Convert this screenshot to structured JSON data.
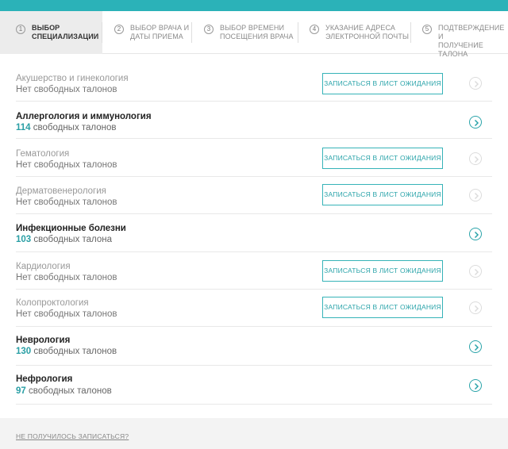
{
  "steps": [
    {
      "number": "1",
      "label_line1": "ВЫБОР",
      "label_line2": "СПЕЦИАЛИЗАЦИИ"
    },
    {
      "number": "2",
      "label_line1": "ВЫБОР ВРАЧА И",
      "label_line2": "ДАТЫ ПРИЕМА"
    },
    {
      "number": "3",
      "label_line1": "ВЫБОР ВРЕМЕНИ",
      "label_line2": "ПОСЕЩЕНИЯ ВРАЧА"
    },
    {
      "number": "4",
      "label_line1": "УКАЗАНИЕ АДРЕСА",
      "label_line2": "ЭЛЕКТРОННОЙ ПОЧТЫ"
    },
    {
      "number": "5",
      "label_line1": "ПОДТВЕРЖДЕНИЕ И",
      "label_line2": "ПОЛУЧЕНИЕ ТАЛОНА"
    }
  ],
  "specialties": [
    {
      "name": "Акушерство и гинекология",
      "count": "",
      "tickets_text": "Нет свободных талонов",
      "waitlist_label": "ЗАПИСАТЬСЯ В ЛИСТ ОЖИДАНИЯ"
    },
    {
      "name": "Аллергология и иммунология",
      "count": "114",
      "tickets_text": " свободных талонов",
      "waitlist_label": ""
    },
    {
      "name": "Гематология",
      "count": "",
      "tickets_text": "Нет свободных талонов",
      "waitlist_label": "ЗАПИСАТЬСЯ В ЛИСТ ОЖИДАНИЯ"
    },
    {
      "name": "Дерматовенерология",
      "count": "",
      "tickets_text": "Нет свободных талонов",
      "waitlist_label": "ЗАПИСАТЬСЯ В ЛИСТ ОЖИДАНИЯ"
    },
    {
      "name": "Инфекционные болезни",
      "count": "103",
      "tickets_text": " свободных талона",
      "waitlist_label": ""
    },
    {
      "name": "Кардиология",
      "count": "",
      "tickets_text": "Нет свободных талонов",
      "waitlist_label": "ЗАПИСАТЬСЯ В ЛИСТ ОЖИДАНИЯ"
    },
    {
      "name": "Колопроктология",
      "count": "",
      "tickets_text": "Нет свободных талонов",
      "waitlist_label": "ЗАПИСАТЬСЯ В ЛИСТ ОЖИДАНИЯ"
    },
    {
      "name": "Неврология",
      "count": "130",
      "tickets_text": " свободных талонов",
      "waitlist_label": ""
    },
    {
      "name": "Нефрология",
      "count": "97",
      "tickets_text": " свободных талонов",
      "waitlist_label": ""
    }
  ],
  "footer": {
    "help_link": "НЕ ПОЛУЧИЛОСЬ ЗАПИСАТЬСЯ?"
  },
  "colors": {
    "accent": "#2bb2b8",
    "muted": "#999999"
  }
}
